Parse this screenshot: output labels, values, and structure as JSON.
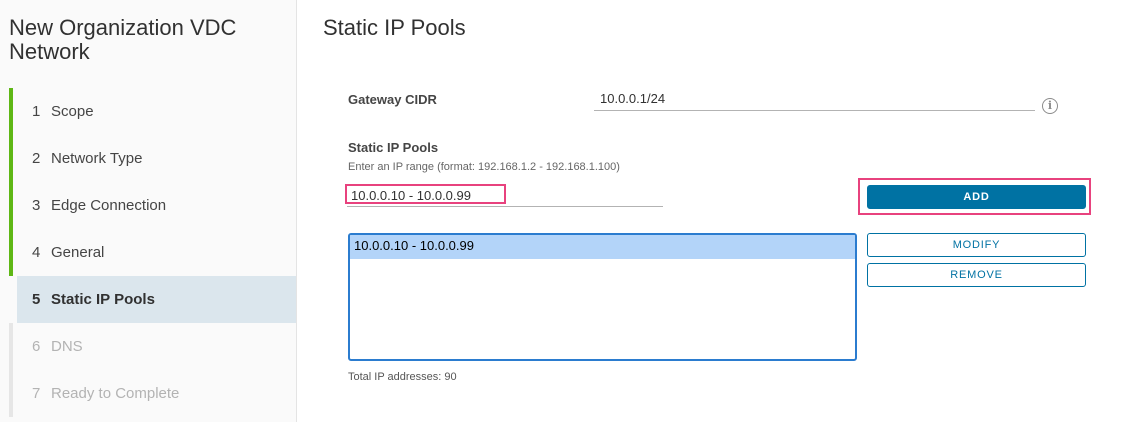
{
  "sidebar": {
    "title": "New Organization VDC Network",
    "steps": [
      {
        "num": "1",
        "label": "Scope"
      },
      {
        "num": "2",
        "label": "Network Type"
      },
      {
        "num": "3",
        "label": "Edge Connection"
      },
      {
        "num": "4",
        "label": "General"
      },
      {
        "num": "5",
        "label": "Static IP Pools"
      },
      {
        "num": "6",
        "label": "DNS"
      },
      {
        "num": "7",
        "label": "Ready to Complete"
      }
    ]
  },
  "main": {
    "title": "Static IP Pools",
    "gateway_cidr_label": "Gateway CIDR",
    "gateway_cidr_value": "10.0.0.1/24",
    "info_icon": "info-icon",
    "pools_label": "Static IP Pools",
    "pools_hint": "Enter an IP range (format: 192.168.1.2 - 192.168.1.100)",
    "range_input_value": "10.0.0.10 - 10.0.0.99",
    "add_label": "ADD",
    "modify_label": "MODIFY",
    "remove_label": "REMOVE",
    "pools": [
      "10.0.0.10 - 10.0.0.99"
    ],
    "total_text": "Total IP addresses: 90"
  },
  "colors": {
    "accent": "#0072a3",
    "step_complete": "#5eb715",
    "highlight": "#e8427e",
    "selection": "#b3d4f9"
  }
}
